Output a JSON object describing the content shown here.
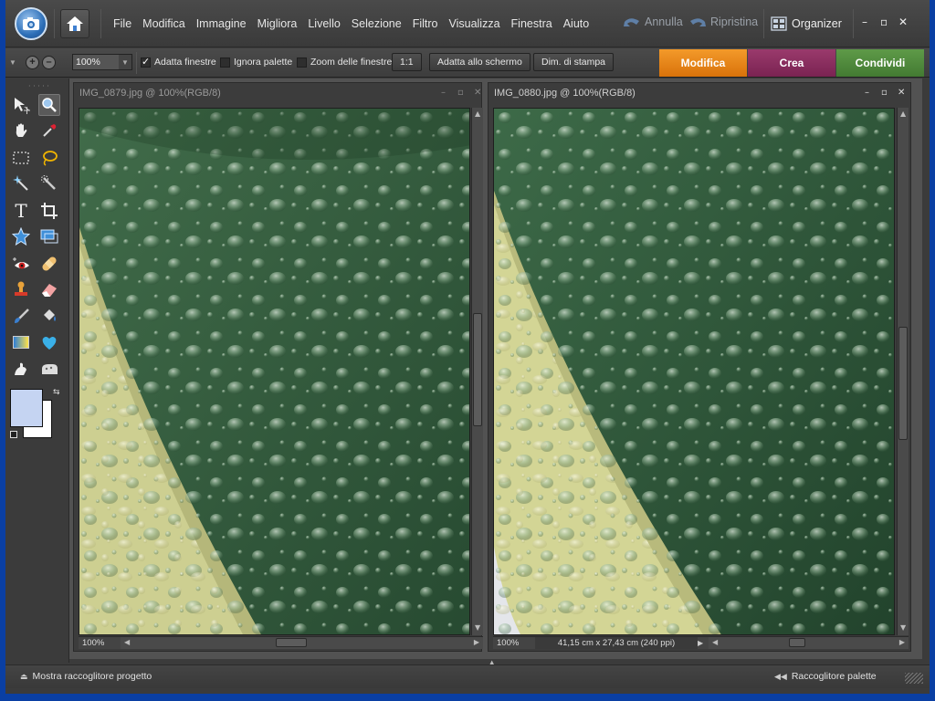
{
  "menubar": {
    "items": [
      "File",
      "Modifica",
      "Immagine",
      "Migliora",
      "Livello",
      "Selezione",
      "Filtro",
      "Visualizza",
      "Finestra",
      "Aiuto"
    ],
    "undo_label": "Annulla",
    "redo_label": "Ripristina",
    "organizer_label": "Organizer"
  },
  "optionsbar": {
    "zoom_value": "100%",
    "fit_windows_label": "Adatta finestre",
    "fit_windows_checked": true,
    "ignore_palettes_label": "Ignora palette",
    "ignore_palettes_checked": false,
    "zoom_all_label": "Zoom delle finestre",
    "zoom_all_checked": false,
    "btn_1to1": "1:1",
    "btn_fit_screen": "Adatta allo schermo",
    "btn_print_size": "Dim. di stampa"
  },
  "mode_tabs": [
    {
      "label": "Modifica",
      "color": "#e8820c"
    },
    {
      "label": "Crea",
      "color": "#8b2a5e"
    },
    {
      "label": "Condividi",
      "color": "#4f8a3c"
    }
  ],
  "documents": [
    {
      "title": "IMG_0879.jpg @ 100%(RGB/8)",
      "zoom": "100%",
      "info": ""
    },
    {
      "title": "IMG_0880.jpg @ 100%(RGB/8)",
      "zoom": "100%",
      "info": "41,15 cm x 27,43 cm (240 ppi)"
    }
  ],
  "statusbar": {
    "project_bin_label": "Mostra raccoglitore progetto",
    "palette_bin_label": "Raccoglitore palette"
  },
  "colors": {
    "foreground": "#c5d4f2",
    "background": "#ffffff",
    "leaf_green": "#2f5a3a",
    "leaf_yellow": "#c8c98a"
  }
}
